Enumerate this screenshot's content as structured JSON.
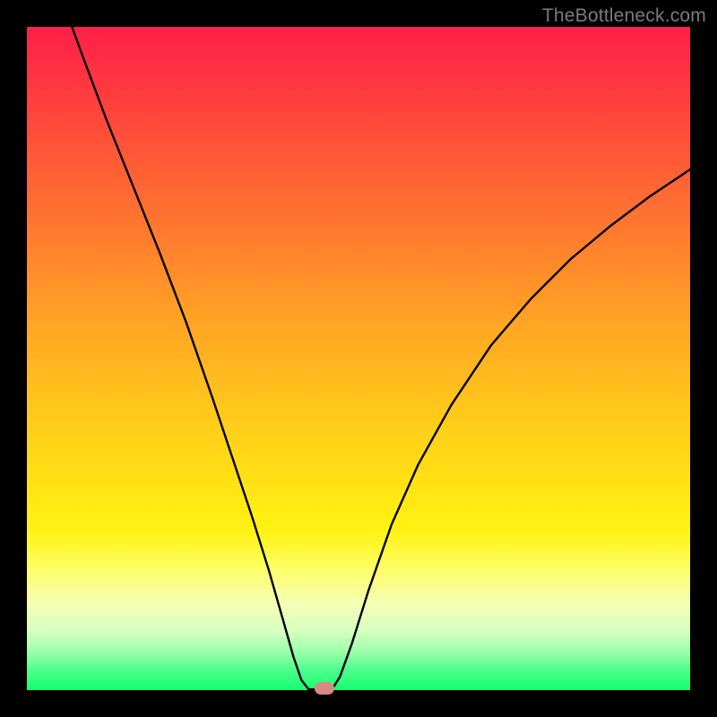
{
  "watermark": "TheBottleneck.com",
  "chart_data": {
    "type": "line",
    "title": "",
    "xlabel": "",
    "ylabel": "",
    "xlim": [
      0,
      1
    ],
    "ylim": [
      0,
      1
    ],
    "series": [
      {
        "name": "curve",
        "points": [
          {
            "x": 0.068,
            "y": 1.0
          },
          {
            "x": 0.09,
            "y": 0.94
          },
          {
            "x": 0.12,
            "y": 0.86
          },
          {
            "x": 0.16,
            "y": 0.76
          },
          {
            "x": 0.2,
            "y": 0.66
          },
          {
            "x": 0.24,
            "y": 0.555
          },
          {
            "x": 0.28,
            "y": 0.44
          },
          {
            "x": 0.31,
            "y": 0.35
          },
          {
            "x": 0.34,
            "y": 0.26
          },
          {
            "x": 0.365,
            "y": 0.18
          },
          {
            "x": 0.385,
            "y": 0.11
          },
          {
            "x": 0.402,
            "y": 0.05
          },
          {
            "x": 0.414,
            "y": 0.015
          },
          {
            "x": 0.425,
            "y": 0.001
          },
          {
            "x": 0.46,
            "y": 0.001
          },
          {
            "x": 0.472,
            "y": 0.02
          },
          {
            "x": 0.49,
            "y": 0.07
          },
          {
            "x": 0.515,
            "y": 0.15
          },
          {
            "x": 0.55,
            "y": 0.25
          },
          {
            "x": 0.59,
            "y": 0.34
          },
          {
            "x": 0.64,
            "y": 0.43
          },
          {
            "x": 0.7,
            "y": 0.52
          },
          {
            "x": 0.76,
            "y": 0.59
          },
          {
            "x": 0.82,
            "y": 0.65
          },
          {
            "x": 0.88,
            "y": 0.7
          },
          {
            "x": 0.94,
            "y": 0.745
          },
          {
            "x": 1.0,
            "y": 0.785
          }
        ]
      }
    ],
    "marker": {
      "x": 0.448,
      "y": 0.003
    },
    "gradient_stops": [
      {
        "pos": 0.0,
        "color": "#ff1f4a"
      },
      {
        "pos": 0.5,
        "color": "#ffc31c"
      },
      {
        "pos": 0.82,
        "color": "#fdff6a"
      },
      {
        "pos": 1.0,
        "color": "#13ff72"
      }
    ]
  }
}
